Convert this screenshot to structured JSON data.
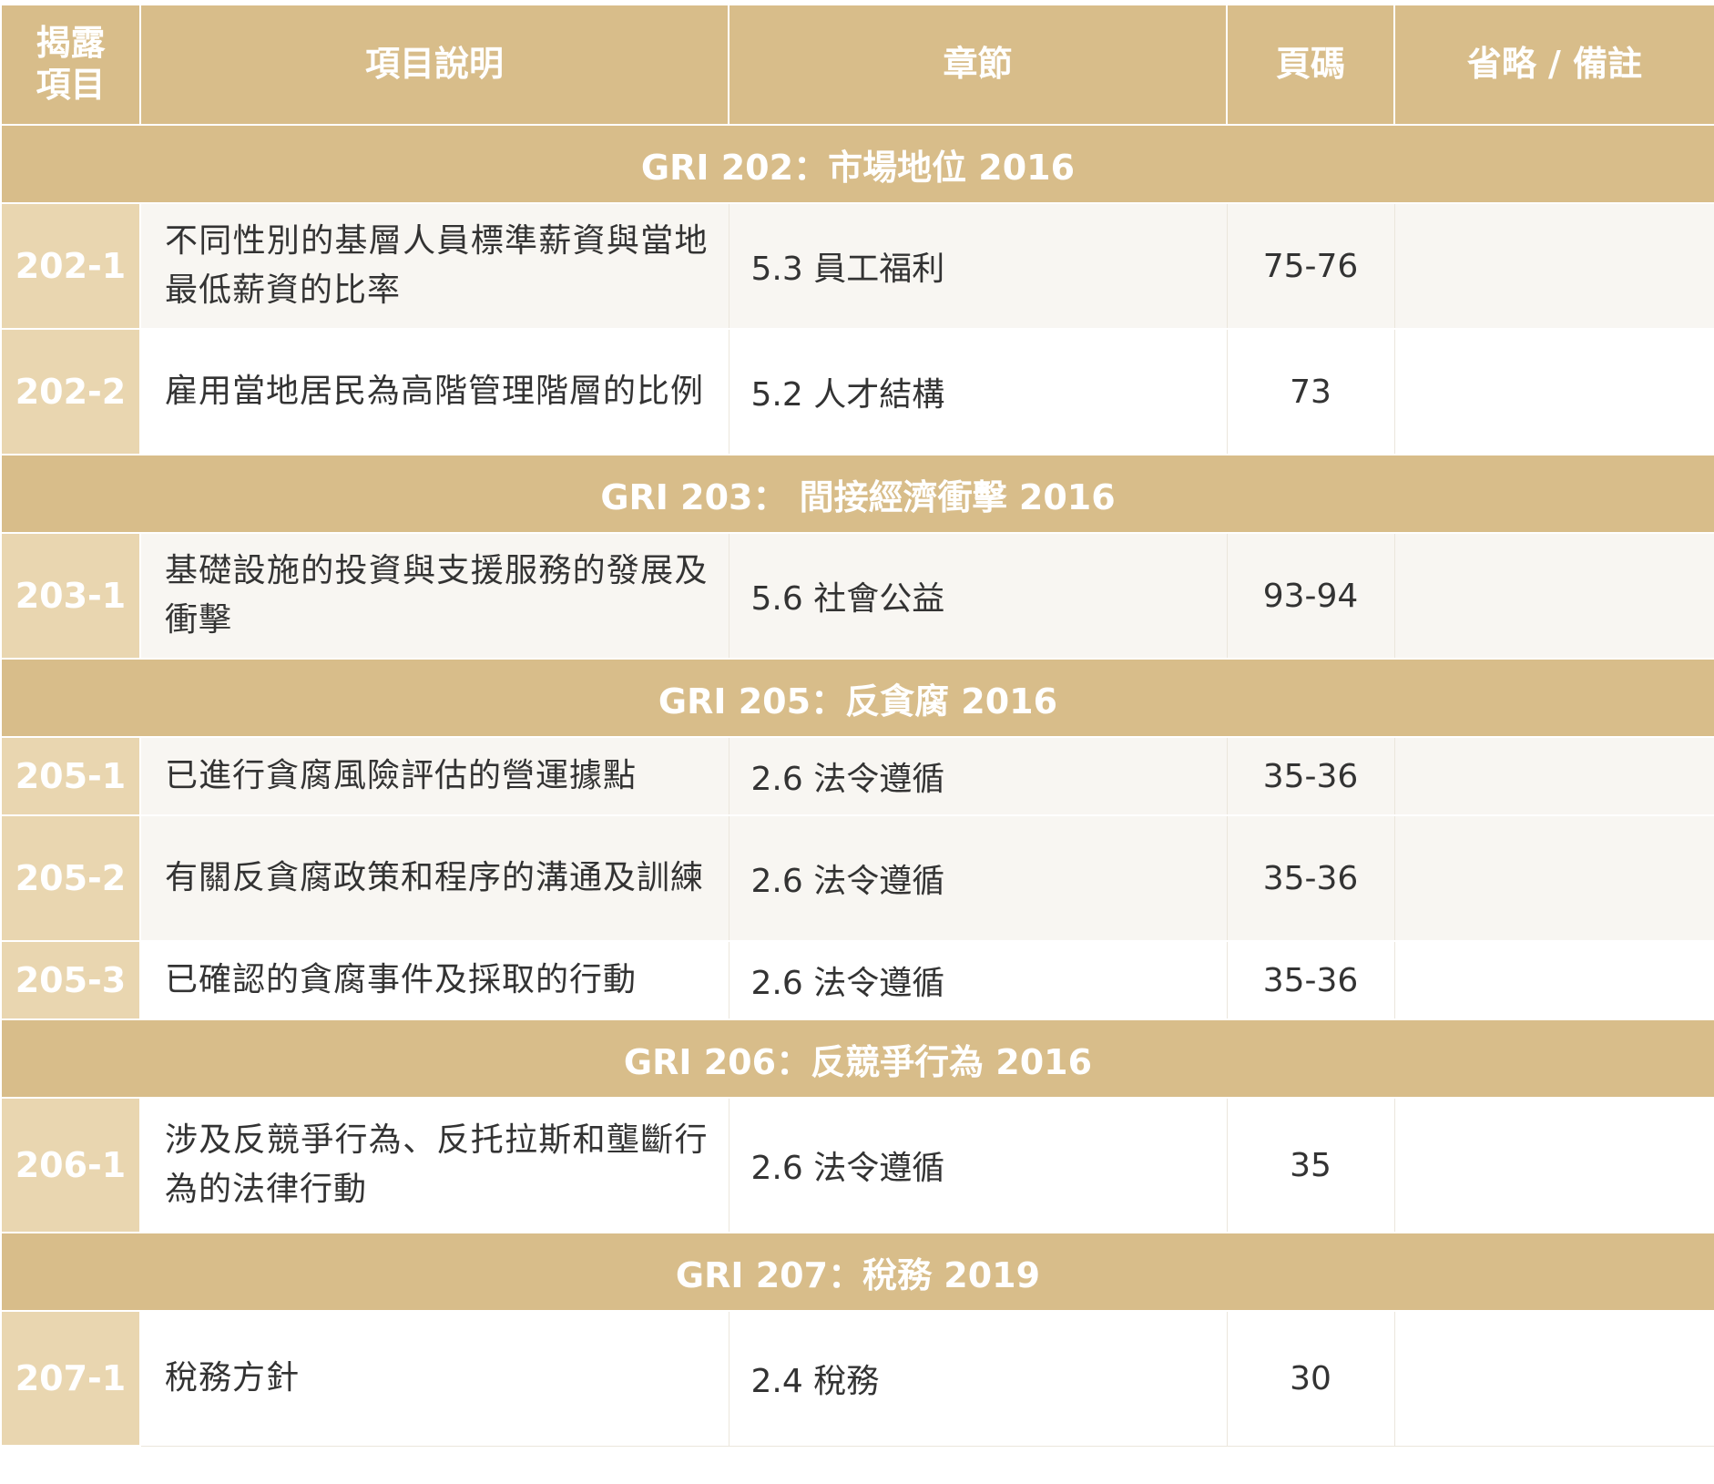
{
  "headers": {
    "item": "揭露\n項目",
    "desc": "項目說明",
    "chapter": "章節",
    "page": "頁碼",
    "note": "省略 / 備註"
  },
  "sections": [
    {
      "title": "GRI 202：市場地位 2016",
      "rows": [
        {
          "code": "202-1",
          "desc": "不同性別的基層人員標準薪資與當地最低薪資的比率",
          "chapter": "5.3 員工福利",
          "page": "75-76",
          "note": ""
        },
        {
          "code": "202-2",
          "desc": "雇用當地居民為高階管理階層的比例",
          "chapter": "5.2 人才結構",
          "page": "73",
          "note": ""
        }
      ]
    },
    {
      "title": "GRI 203： 間接經濟衝擊 2016",
      "rows": [
        {
          "code": "203-1",
          "desc": "基礎設施的投資與支援服務的發展及衝擊",
          "chapter": "5.6 社會公益",
          "page": "93-94",
          "note": ""
        }
      ]
    },
    {
      "title": "GRI 205：反貪腐 2016",
      "rows": [
        {
          "code": "205-1",
          "desc": "已進行貪腐風險評估的營運據點",
          "chapter": "2.6 法令遵循",
          "page": "35-36",
          "note": ""
        },
        {
          "code": "205-2",
          "desc": "有關反貪腐政策和程序的溝通及訓練",
          "chapter": "2.6 法令遵循",
          "page": "35-36",
          "note": ""
        },
        {
          "code": "205-3",
          "desc": "已確認的貪腐事件及採取的行動",
          "chapter": "2.6 法令遵循",
          "page": "35-36",
          "note": ""
        }
      ]
    },
    {
      "title": "GRI 206：反競爭行為 2016",
      "rows": [
        {
          "code": "206-1",
          "desc": "涉及反競爭行為、反托拉斯和壟斷行為的法律行動",
          "chapter": "2.6 法令遵循",
          "page": "35",
          "note": ""
        }
      ]
    },
    {
      "title": "GRI 207：稅務 2019",
      "rows": [
        {
          "code": "207-1",
          "desc": "稅務方針",
          "chapter": "2.4 稅務",
          "page": "30",
          "note": ""
        }
      ]
    }
  ]
}
